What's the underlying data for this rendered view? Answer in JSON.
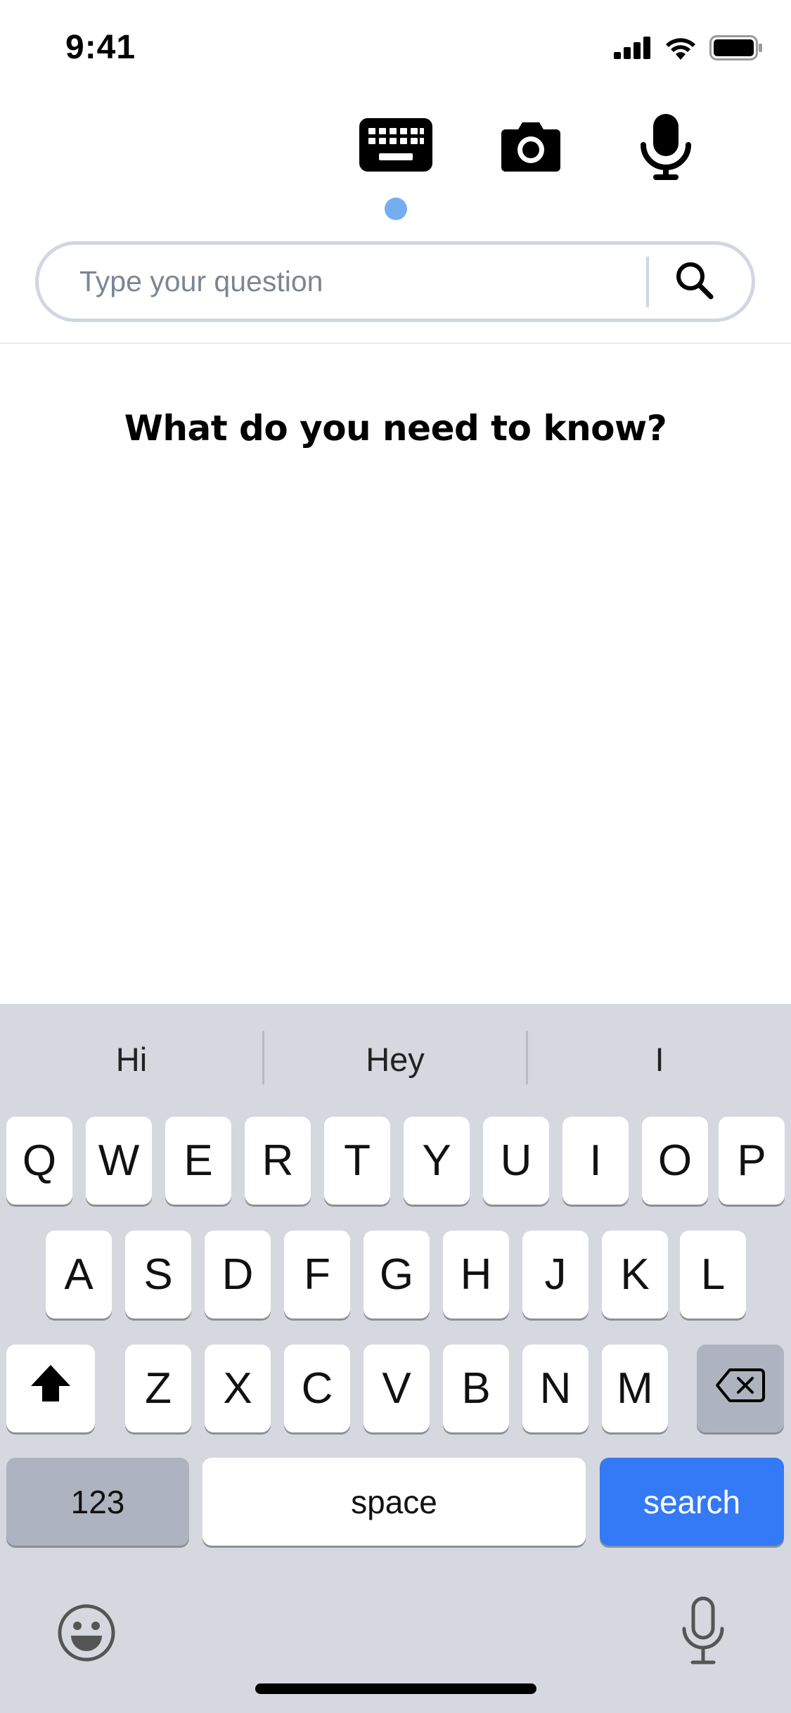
{
  "status_bar": {
    "time": "9:41",
    "icons": [
      "signal-icon",
      "wifi-icon",
      "battery-icon"
    ]
  },
  "modes": {
    "items": [
      "keyboard-icon",
      "camera-icon",
      "microphone-icon"
    ],
    "selected": "keyboard",
    "indicator_color": "#74aef0"
  },
  "search": {
    "placeholder": "Type your question",
    "value": "",
    "icon": "search-icon"
  },
  "main": {
    "title": "What do you need to know?"
  },
  "keyboard": {
    "suggestions": [
      "Hi",
      "Hey",
      "I"
    ],
    "row1": [
      "Q",
      "W",
      "E",
      "R",
      "T",
      "Y",
      "U",
      "I",
      "O",
      "P"
    ],
    "row2": [
      "A",
      "S",
      "D",
      "F",
      "G",
      "H",
      "J",
      "K",
      "L"
    ],
    "row3": [
      "Z",
      "X",
      "C",
      "V",
      "B",
      "N",
      "M"
    ],
    "numbers_label": "123",
    "space_label": "space",
    "return_label": "search",
    "return_color": "#3479f6",
    "bottom_icons": [
      "emoji-icon",
      "dictation-icon"
    ]
  }
}
